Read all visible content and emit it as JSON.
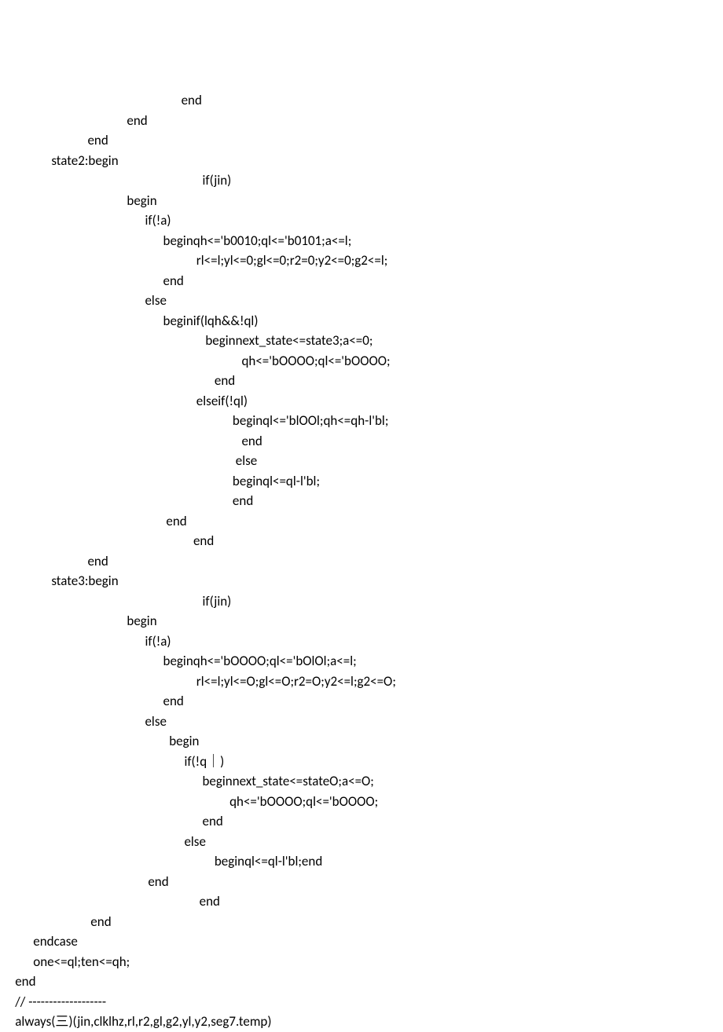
{
  "code_lines": [
    "                                                            end",
    "                                          end",
    "                             end",
    "                 state2:begin",
    "                                                                   if(jin)",
    "                                          begin",
    "                                                if(!a)",
    "                                                      beginqh<='b0010;ql<='b0101;a<=l;",
    "                                                                 rl<=l;yl<=0;gl<=0;r2=0;y2<=0;g2<=l;",
    "                                                      end",
    "                                                else",
    "                                                      beginif(lqh&&!ql)",
    "                                                                    beginnext_state<=state3;a<=0;",
    "                                                                                qh<='bOOOO;ql<='bOOOO;",
    "                                                                       end",
    "                                                                 elseif(!ql)",
    "                                                                             beginql<='blOOl;qh<=qh-l'bl;",
    "                                                                                end",
    "                                                                              else",
    "                                                                             beginql<=ql-l'bl;",
    "                                                                             end",
    "                                                       end",
    "                                                                end",
    "                             end",
    "                 state3:begin",
    "                                                                   if(jin)",
    "                                          begin",
    "                                                if(!a)",
    "                                                      beginqh<='bOOOO;ql<='bOlOl;a<=l;",
    "                                                                 rl<=l;yl<=O;gl<=O;r2=O;y2<=l;g2<=O;",
    "                                                      end",
    "                                                else",
    "                                                        begin",
    "                                                             if(!q｜)",
    "                                                                   beginnext_state<=stateO;a<=O;",
    "                                                                            qh<='bOOOO;ql<='bOOOO;",
    "                                                                   end",
    "                                                             else",
    "                                                                       beginql<=ql-l'bl;end",
    "                                                 end",
    "                                                                  end",
    "                              end",
    "           endcase",
    "           one<=ql;ten<=qh;",
    "     end",
    "     // -------------------",
    "     always(三)(jin,clklhz,rl,r2,gl,g2,yl,y2,seg7.temp)"
  ]
}
